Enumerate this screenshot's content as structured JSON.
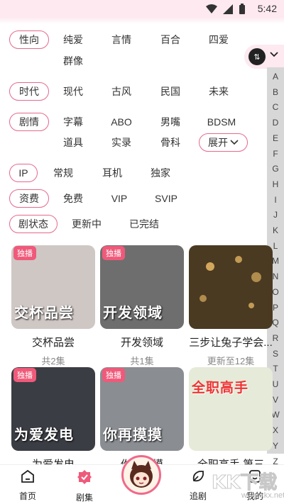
{
  "status": {
    "time": "5:42"
  },
  "filters": {
    "xingxiang": {
      "label": "性向",
      "options": [
        "纯爱",
        "言情",
        "百合",
        "四爱",
        "群像"
      ]
    },
    "shidai": {
      "label": "时代",
      "options": [
        "现代",
        "古风",
        "民国",
        "未来"
      ]
    },
    "juqing": {
      "label": "剧情",
      "options": [
        "字幕",
        "ABO",
        "男嘴",
        "BDSM",
        "道具",
        "实录",
        "骨科"
      ],
      "expand": "展开"
    },
    "ip": {
      "label": "IP",
      "options": [
        "常规",
        "耳机",
        "独家"
      ]
    },
    "zifei": {
      "label": "资费",
      "options": [
        "免费",
        "VIP",
        "SVIP"
      ]
    },
    "juzhuangtai": {
      "label": "剧状态",
      "options": [
        "更新中",
        "已完结"
      ]
    }
  },
  "alphabet": [
    "A",
    "B",
    "C",
    "D",
    "E",
    "F",
    "G",
    "H",
    "I",
    "J",
    "K",
    "L",
    "M",
    "N",
    "O",
    "P",
    "Q",
    "R",
    "S",
    "T",
    "U",
    "V",
    "W",
    "X",
    "Y",
    "Z"
  ],
  "cards": [
    {
      "badge": "独播",
      "cover_text": "交杯品尝",
      "title": "交杯品尝",
      "sub": "共2集",
      "bg": "#cfc7c4"
    },
    {
      "badge": "独播",
      "cover_text": "开发领域",
      "title": "开发领域",
      "sub": "共1集",
      "bg": "#6e6e6e"
    },
    {
      "badge": "",
      "cover_text": "",
      "title": "三步让兔子学会...",
      "sub": "更新至12集",
      "bg": "#4a3a22"
    },
    {
      "badge": "独播",
      "cover_text": "为爱发电",
      "title": "为爱发电",
      "sub": "",
      "bg": "#3b3d44"
    },
    {
      "badge": "独播",
      "cover_text": "你再摸摸",
      "title": "你再摸摸",
      "sub": "",
      "bg": "#8a8d92"
    },
    {
      "badge": "",
      "cover_text": "全职高手",
      "title": "全职高手 第三",
      "sub": "",
      "bg": "#e6ead8"
    }
  ],
  "tabs": {
    "home": "首页",
    "drama": "剧集",
    "follow": "追剧",
    "mine": "我的"
  },
  "watermark": {
    "logo": "KK下载",
    "url": "www.kkx.net"
  }
}
